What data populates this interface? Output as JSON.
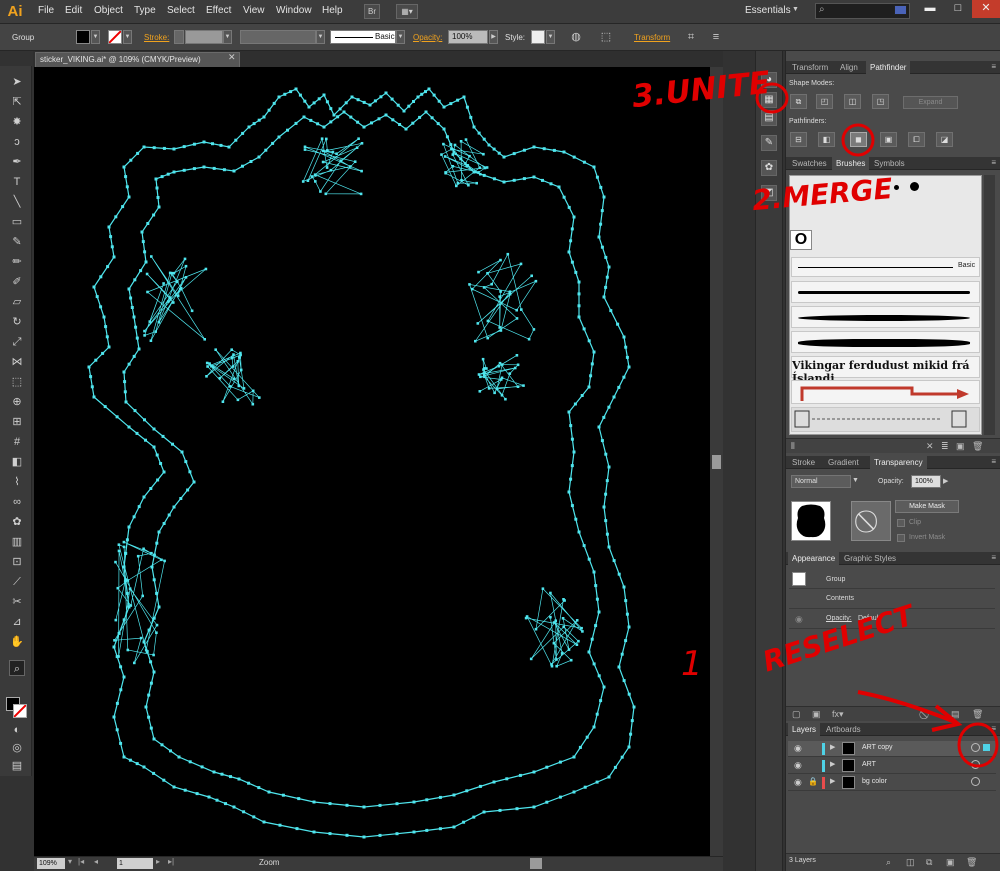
{
  "app": {
    "logo": "Ai"
  },
  "menu": [
    "File",
    "Edit",
    "Object",
    "Type",
    "Select",
    "Effect",
    "View",
    "Window",
    "Help"
  ],
  "menubar": {
    "bridge_label": "Br",
    "workspace": "Essentials"
  },
  "control_bar": {
    "selection": "Group",
    "stroke_label": "Stroke:",
    "brush_basic": "Basic",
    "opacity_label": "Opacity:",
    "opacity_value": "100%",
    "style_label": "Style:",
    "transform_label": "Transform"
  },
  "document": {
    "tab_title": "sticker_VIKING.ai* @ 109% (CMYK/Preview)"
  },
  "status_bar": {
    "zoom": "109%",
    "page": "1",
    "status": "Zoom"
  },
  "panels": {
    "pathfinder_tabs": [
      "Transform",
      "Align",
      "Pathfinder"
    ],
    "shape_modes_label": "Shape Modes:",
    "pathfinders_label": "Pathfinders:",
    "expand_label": "Expand",
    "swatches_tabs": [
      "Swatches",
      "Brushes",
      "Symbols"
    ],
    "brush_basic_label": "Basic",
    "brush_text_sample": "Vikingar ferdudust mikid frá Íslandi",
    "transparency_tabs": [
      "Stroke",
      "Gradient",
      "Transparency"
    ],
    "blend_mode": "Normal",
    "opacity_label": "Opacity:",
    "opacity_value": "100%",
    "make_mask": "Make Mask",
    "clip_label": "Clip",
    "invert_mask_label": "Invert Mask",
    "appearance_tabs": [
      "Appearance",
      "Graphic Styles"
    ],
    "appearance_group": "Group",
    "appearance_contents": "Contents",
    "appearance_opacity_label": "Opacity:",
    "appearance_opacity_value": "Default",
    "layers_tabs": [
      "Layers",
      "Artboards"
    ],
    "layers": [
      {
        "name": "ART copy",
        "color": "#4fd2e6",
        "locked": false,
        "selected": true
      },
      {
        "name": "ART",
        "color": "#4fd2e6",
        "locked": false,
        "selected": false
      },
      {
        "name": "bg color",
        "color": "#e84c4c",
        "locked": true,
        "selected": false
      }
    ],
    "layers_count": "3 Layers"
  },
  "annotations": {
    "unite": "3.UNITE",
    "merge": "2.MERGE",
    "reselect": "RESELECT",
    "step_one": "1"
  },
  "colors": {
    "path_cyan": "#4fe6ee",
    "accent_orange": "#f0a21e",
    "annotation_red": "#e00000"
  }
}
